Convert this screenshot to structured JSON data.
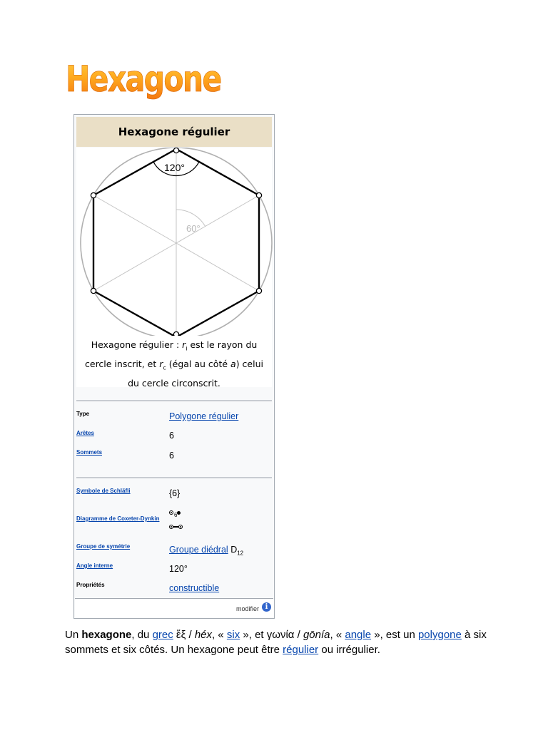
{
  "page": {
    "title": "Hexagone"
  },
  "infobox": {
    "header": "Hexagone régulier",
    "diagram": {
      "vertex_angle": "120°",
      "central_angle": "60°"
    },
    "caption": {
      "part1": "Hexagone régulier : ",
      "ri_var": "r",
      "ri_sub": "i",
      "part2": " est le rayon du cercle inscrit, et ",
      "rc_var": "r",
      "rc_sub": "c",
      "part3": " (égal au côté ",
      "a_var": "a",
      "part4": ") celui du cercle circonscrit."
    },
    "rows1": [
      {
        "label": "Type",
        "label_is_link": false,
        "value": "Polygone régulier",
        "value_is_link": true
      },
      {
        "label": "Arêtes",
        "label_is_link": true,
        "value": "6",
        "value_is_link": false
      },
      {
        "label": "Sommets",
        "label_is_link": true,
        "value": "6",
        "value_is_link": false
      }
    ],
    "rows2": {
      "schlafli": {
        "label": "Symbole de Schläfli",
        "value": "{6}"
      },
      "coxeter": {
        "label": "Diagramme de Coxeter-Dynkin",
        "order": "6"
      },
      "symmetry": {
        "label": "Groupe de symétrie",
        "value": "Groupe diédral",
        "suffix": "D",
        "suffix_sub": "12"
      },
      "angle": {
        "label": "Angle interne",
        "value": "120°"
      },
      "props": {
        "label": "Propriétés",
        "value": "constructible"
      }
    },
    "footer": {
      "edit_label": "modifier",
      "info_glyph": "i"
    }
  },
  "intro": {
    "t1": "Un ",
    "hexagone_bold": "hexagone",
    "t2": ", du ",
    "grec_link": "grec",
    "t3": " ἕξ / ",
    "hex_italic": "héx",
    "t4": ", « ",
    "six_link": "six",
    "t5": " », et γωνία / ",
    "gonia_italic": "gōnía",
    "t6": ", « ",
    "angle_link": "angle",
    "t7": " », est un ",
    "polygone_link": "polygone",
    "t8": " à six sommets et six côtés. Un hexagone peut être ",
    "regulier_link": "régulier",
    "t9": " ou irrégulier."
  }
}
